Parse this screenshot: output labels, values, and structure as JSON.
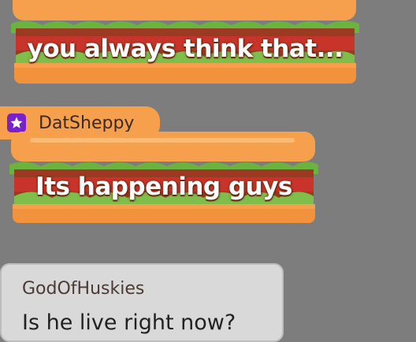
{
  "messages": [
    {
      "author": "",
      "text": "you always think that..."
    },
    {
      "author": "DatSheppy",
      "badge_icon": "star-icon",
      "text": "Its happening guys"
    },
    {
      "author": "GodOfHuskies",
      "text": "Is he live right now?"
    }
  ],
  "colors": {
    "background": "#7d7d7d",
    "bun": "#f6a04d",
    "badge": "#7b21c9",
    "lettuce": "#6bb33f",
    "plain_bubble": "#d9d9d9"
  }
}
